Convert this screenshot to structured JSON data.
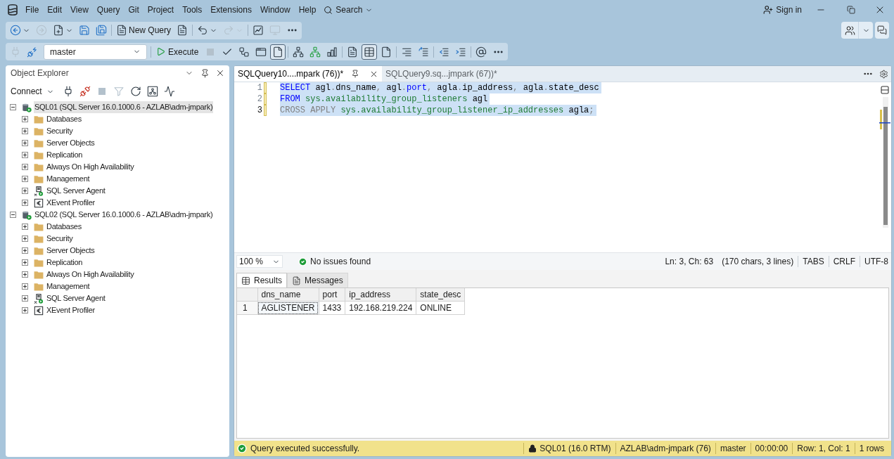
{
  "title_bar": {
    "menu": [
      "File",
      "Edit",
      "View",
      "Query",
      "Git",
      "Project",
      "Tools",
      "Extensions",
      "Window",
      "Help"
    ],
    "search": "Search",
    "sign_in": "Sign in"
  },
  "standard_toolbar": {
    "groups": [
      [
        {
          "kind": "back",
          "disabled": false,
          "dropdown": true
        },
        {
          "kind": "forward",
          "disabled": true,
          "dropdown": false
        },
        {
          "kind": "new-file",
          "disabled": false,
          "dropdown": true
        },
        {
          "kind": "save",
          "disabled": false,
          "dropdown": false
        },
        {
          "kind": "save-all",
          "disabled": false,
          "dropdown": false
        }
      ],
      [
        {
          "kind": "new-query",
          "label": "New Query",
          "disabled": false,
          "dropdown": false
        },
        {
          "kind": "query-file",
          "disabled": false,
          "dropdown": false
        }
      ],
      [
        {
          "kind": "undo",
          "disabled": false,
          "dropdown": true
        },
        {
          "kind": "redo",
          "disabled": true,
          "dropdown": true
        }
      ],
      [
        {
          "kind": "chart",
          "disabled": false,
          "dropdown": false
        },
        {
          "kind": "monitor",
          "disabled": true,
          "dropdown": false
        },
        {
          "kind": "more",
          "disabled": false,
          "dropdown": false
        }
      ]
    ]
  },
  "query_toolbar": {
    "groups": [
      [
        {
          "kind": "connect",
          "disabled": true,
          "selected": false
        },
        {
          "kind": "change-connection",
          "disabled": false,
          "selected": false
        },
        {
          "kind": "database",
          "value": "master",
          "disabled": false,
          "selected": false
        }
      ],
      [
        {
          "kind": "execute",
          "label": "Execute",
          "disabled": false,
          "selected": false
        },
        {
          "kind": "stop",
          "disabled": true,
          "selected": false
        },
        {
          "kind": "parse",
          "disabled": false,
          "selected": false
        },
        {
          "kind": "plan",
          "disabled": false,
          "selected": false
        },
        {
          "kind": "query-options",
          "disabled": false,
          "selected": false
        },
        {
          "kind": "intellisense",
          "disabled": false,
          "selected": true
        }
      ],
      [
        {
          "kind": "actual-plan",
          "disabled": false,
          "selected": false
        },
        {
          "kind": "live-stats",
          "disabled": false,
          "selected": false
        },
        {
          "kind": "client-stats",
          "disabled": false,
          "selected": false
        }
      ],
      [
        {
          "kind": "results-text",
          "disabled": false,
          "selected": false
        },
        {
          "kind": "results-grid",
          "disabled": false,
          "selected": true
        },
        {
          "kind": "results-file",
          "disabled": false,
          "selected": false
        }
      ],
      [
        {
          "kind": "comment",
          "disabled": false,
          "selected": false
        },
        {
          "kind": "uncomment",
          "disabled": false,
          "selected": false
        }
      ],
      [
        {
          "kind": "outdent",
          "disabled": false,
          "selected": false
        },
        {
          "kind": "indent",
          "disabled": false,
          "selected": false
        }
      ],
      [
        {
          "kind": "parameters",
          "disabled": false,
          "selected": false
        },
        {
          "kind": "more",
          "disabled": false,
          "selected": false
        }
      ]
    ]
  },
  "object_explorer": {
    "title": "Object Explorer",
    "toolbar": {
      "connect": "Connect",
      "buttons": [
        {
          "kind": "connect",
          "disabled": false
        },
        {
          "kind": "disconnect",
          "disabled": false
        },
        {
          "kind": "stop",
          "disabled": true
        },
        {
          "kind": "filter",
          "disabled": true
        },
        {
          "kind": "refresh",
          "disabled": false
        },
        {
          "kind": "activity-monitor",
          "disabled": false
        },
        {
          "kind": "profiler",
          "disabled": false
        }
      ]
    },
    "tree": [
      {
        "label": "SQL01 (SQL Server 16.0.1000.6 - AZLAB\\adm-jmpark)",
        "kind": "server",
        "expanded": true,
        "selected": true,
        "children": [
          {
            "label": "Databases",
            "kind": "folder",
            "expanded": false,
            "selected": false
          },
          {
            "label": "Security",
            "kind": "folder",
            "expanded": false,
            "selected": false
          },
          {
            "label": "Server Objects",
            "kind": "folder",
            "expanded": false,
            "selected": false
          },
          {
            "label": "Replication",
            "kind": "folder",
            "expanded": false,
            "selected": false
          },
          {
            "label": "Always On High Availability",
            "kind": "folder",
            "expanded": false,
            "selected": false
          },
          {
            "label": "Management",
            "kind": "folder",
            "expanded": false,
            "selected": false
          },
          {
            "label": "SQL Server Agent",
            "kind": "agent",
            "expanded": false,
            "selected": false
          },
          {
            "label": "XEvent Profiler",
            "kind": "profiler",
            "expanded": false,
            "selected": false
          }
        ]
      },
      {
        "label": "SQL02 (SQL Server 16.0.1000.6 - AZLAB\\adm-jmpark)",
        "kind": "server",
        "expanded": true,
        "selected": false,
        "children": [
          {
            "label": "Databases",
            "kind": "folder",
            "expanded": false,
            "selected": false
          },
          {
            "label": "Security",
            "kind": "folder",
            "expanded": false,
            "selected": false
          },
          {
            "label": "Server Objects",
            "kind": "folder",
            "expanded": false,
            "selected": false
          },
          {
            "label": "Replication",
            "kind": "folder",
            "expanded": false,
            "selected": false
          },
          {
            "label": "Always On High Availability",
            "kind": "folder",
            "expanded": false,
            "selected": false
          },
          {
            "label": "Management",
            "kind": "folder",
            "expanded": false,
            "selected": false
          },
          {
            "label": "SQL Server Agent",
            "kind": "agent",
            "expanded": false,
            "selected": false
          },
          {
            "label": "XEvent Profiler",
            "kind": "profiler",
            "expanded": false,
            "selected": false
          }
        ]
      }
    ]
  },
  "editor": {
    "tabs": [
      {
        "label": "SQLQuery10....mpark (76))*",
        "selected": true
      },
      {
        "label": "SQLQuery9.sq...jmpark (67))*",
        "selected": false
      }
    ],
    "lines": [
      {
        "number": "1",
        "current": false,
        "modified": true,
        "selected": true,
        "tokens": [
          {
            "text": "SELECT",
            "kind": "keyword"
          },
          {
            "text": " agl",
            "kind": "identifier"
          },
          {
            "text": ".",
            "kind": "punctuation"
          },
          {
            "text": "dns_name",
            "kind": "identifier"
          },
          {
            "text": ",",
            "kind": "punctuation"
          },
          {
            "text": " agl",
            "kind": "identifier"
          },
          {
            "text": ".",
            "kind": "punctuation"
          },
          {
            "text": "port",
            "kind": "keyword"
          },
          {
            "text": ",",
            "kind": "punctuation"
          },
          {
            "text": " agla",
            "kind": "identifier"
          },
          {
            "text": ".",
            "kind": "punctuation"
          },
          {
            "text": "ip_address",
            "kind": "identifier"
          },
          {
            "text": ",",
            "kind": "punctuation"
          },
          {
            "text": " agla",
            "kind": "identifier"
          },
          {
            "text": ".",
            "kind": "punctuation"
          },
          {
            "text": "state_desc",
            "kind": "identifier"
          }
        ]
      },
      {
        "number": "2",
        "current": false,
        "modified": true,
        "selected": true,
        "tokens": [
          {
            "text": "FROM",
            "kind": "keyword"
          },
          {
            "text": " sys.availability_group_listeners",
            "kind": "system"
          },
          {
            "text": " agl",
            "kind": "identifier"
          }
        ]
      },
      {
        "number": "3",
        "current": true,
        "modified": true,
        "selected": true,
        "tokens": [
          {
            "text": "CROSS APPLY",
            "kind": "operator"
          },
          {
            "text": " sys.availability_group_listener_ip_addresses",
            "kind": "system"
          },
          {
            "text": " agla",
            "kind": "identifier"
          },
          {
            "text": ";",
            "kind": "punctuation"
          }
        ]
      }
    ],
    "status": {
      "zoom": "100 %",
      "issues": "No issues found",
      "position": "Ln: 3, Ch: 63",
      "counts": "(170 chars, 3 lines)",
      "indentation": "TABS",
      "line_endings": "CRLF",
      "encoding": "UTF-8"
    }
  },
  "results": {
    "tabs": [
      {
        "label": "Results",
        "kind": "grid",
        "selected": true
      },
      {
        "label": "Messages",
        "kind": "messages",
        "selected": false
      }
    ],
    "columns": [
      "dns_name",
      "port",
      "ip_address",
      "state_desc"
    ],
    "rows": [
      {
        "number": "1",
        "cells": [
          {
            "text": "AGLISTENER",
            "focused": true
          },
          {
            "text": "1433",
            "focused": false
          },
          {
            "text": "192.168.219.224",
            "focused": false
          },
          {
            "text": "ONLINE",
            "focused": false
          }
        ]
      }
    ]
  },
  "status_bar": {
    "message": "Query executed successfully.",
    "server": "SQL01 (16.0 RTM)",
    "login": "AZLAB\\adm-jmpark (76)",
    "database": "master",
    "elapsed": "00:00:00",
    "cursor": "Row: 1, Col: 1",
    "row_count": "1 rows"
  }
}
